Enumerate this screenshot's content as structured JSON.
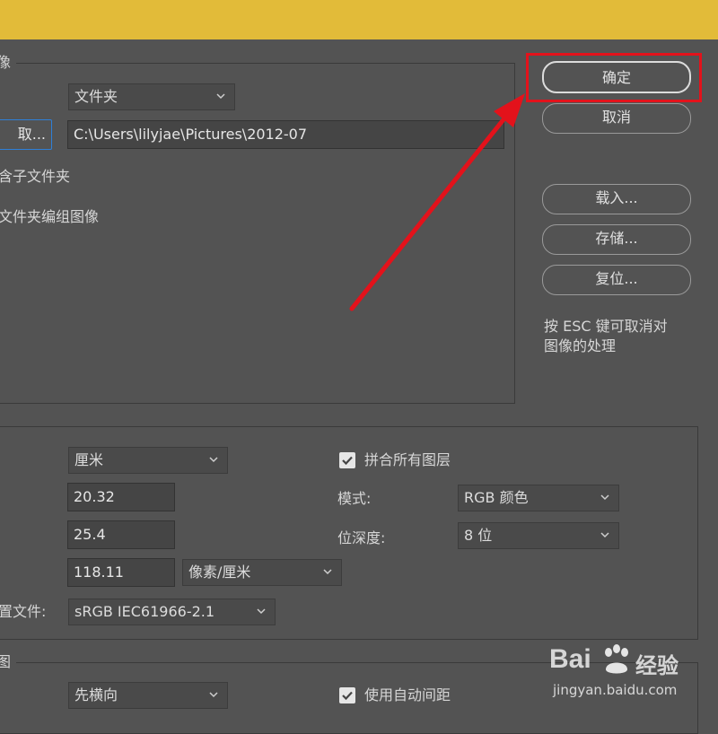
{
  "image_group": {
    "title_fragment": "像",
    "source_select": "文件夹",
    "choose_button": "取...",
    "path_value": "C:\\Users\\lilyjae\\Pictures\\2012-07",
    "include_subfolders": "含子文件夹",
    "group_by_folder": "文件夹编组图像"
  },
  "buttons": {
    "ok": "确定",
    "cancel": "取消",
    "load": "载入...",
    "save": "存储...",
    "reset": "复位..."
  },
  "hint": {
    "line1": "按 ESC 键可取消对",
    "line2": "图像的处理"
  },
  "doc_group": {
    "unit_select": "厘米",
    "width_value": "20.32",
    "height_value": "25.4",
    "resolution_value": "118.11",
    "resolution_unit_select": "像素/厘米",
    "profile_label": "置文件:",
    "profile_select": "sRGB IEC61966-2.1",
    "flatten_label": "拼合所有图层",
    "mode_label": "模式:",
    "mode_select": "RGB 颜色",
    "depth_label": "位深度:",
    "depth_select": "8 位"
  },
  "bottom_group": {
    "title_fragment": "图",
    "order_select": "先横向",
    "auto_spacing_label": "使用自动间距"
  },
  "watermark": {
    "brand_text": "Bai",
    "brand_suffix": "经验",
    "url": "jingyan.baidu.com"
  },
  "colors": {
    "title_bar": "#e2bb39",
    "dialog_bg": "#535353",
    "highlight_red": "#e3121b"
  }
}
